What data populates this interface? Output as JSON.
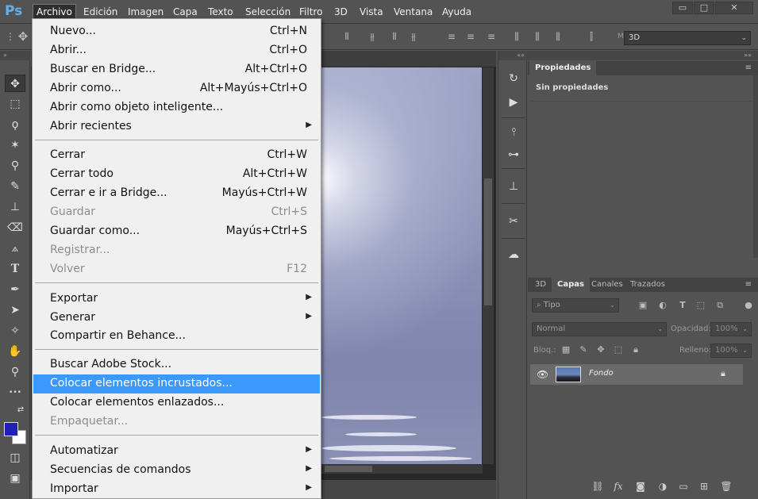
{
  "app": {
    "logo": "Ps"
  },
  "menubar": {
    "items": [
      {
        "label": "Archivo",
        "active": true
      },
      {
        "label": "Edición"
      },
      {
        "label": "Imagen"
      },
      {
        "label": "Capa"
      },
      {
        "label": "Texto"
      },
      {
        "label": "Selección"
      },
      {
        "label": "Filtro"
      },
      {
        "label": "3D"
      },
      {
        "label": "Vista"
      },
      {
        "label": "Ventana"
      },
      {
        "label": "Ayuda"
      }
    ]
  },
  "window_controls": {
    "minimize": "▭",
    "maximize": "□",
    "close": "✕"
  },
  "options_bar": {
    "mode_label": "M",
    "mode_value": "3D"
  },
  "archivo_menu": {
    "items": [
      {
        "label": "Nuevo...",
        "shortcut": "Ctrl+N"
      },
      {
        "label": "Abrir...",
        "shortcut": "Ctrl+O"
      },
      {
        "label": "Buscar en Bridge...",
        "shortcut": "Alt+Ctrl+O"
      },
      {
        "label": "Abrir como...",
        "shortcut": "Alt+Mayús+Ctrl+O"
      },
      {
        "label": "Abrir como objeto inteligente..."
      },
      {
        "label": "Abrir recientes",
        "submenu": true
      },
      {
        "label": "Cerrar",
        "shortcut": "Ctrl+W"
      },
      {
        "label": "Cerrar todo",
        "shortcut": "Alt+Ctrl+W"
      },
      {
        "label": "Cerrar e ir a Bridge...",
        "shortcut": "Mayús+Ctrl+W"
      },
      {
        "label": "Guardar",
        "shortcut": "Ctrl+S",
        "disabled": true
      },
      {
        "label": "Guardar como...",
        "shortcut": "Mayús+Ctrl+S"
      },
      {
        "label": "Registrar...",
        "disabled": true
      },
      {
        "label": "Volver",
        "shortcut": "F12",
        "disabled": true
      },
      {
        "label": "Exportar",
        "submenu": true
      },
      {
        "label": "Generar",
        "submenu": true
      },
      {
        "label": "Compartir en Behance..."
      },
      {
        "label": "Buscar Adobe Stock..."
      },
      {
        "label": "Colocar elementos incrustados...",
        "highlighted": true
      },
      {
        "label": "Colocar elementos enlazados..."
      },
      {
        "label": "Empaquetar...",
        "disabled": true
      },
      {
        "label": "Automatizar",
        "submenu": true
      },
      {
        "label": "Secuencias de comandos",
        "submenu": true
      },
      {
        "label": "Importar",
        "submenu": true
      }
    ],
    "submenu_glyph": "▶",
    "highlight_color": "#3b99fc"
  },
  "tools": {
    "collapse": "»",
    "move": "✥",
    "marquee": "⬚",
    "lasso": "ϙ",
    "wand": "✶",
    "eyedropper": "⚲",
    "brush": "✎",
    "stamp": "⊥",
    "eraser": "⌫",
    "fill": "⟑",
    "type": "T",
    "pen": "✒",
    "path_select": "➤",
    "shape": "✧",
    "hand": "✋",
    "zoom": "⚲",
    "more": "•••",
    "swap": "⇄",
    "quick_mask": "◫",
    "screen_mode": "▣",
    "foreground_color": "#2020b8",
    "background_color": "#ffffff"
  },
  "icon_strip": {
    "collapse": "««"
  },
  "right_panels": {
    "collapse": "»»",
    "properties": {
      "tab": "Propiedades",
      "empty_text": "Sin propiedades"
    },
    "layers": {
      "tabs": [
        "3D",
        "Capas",
        "Canales",
        "Trazados"
      ],
      "active_tab": "Capas",
      "kind_filter": "Tipo",
      "blend_mode": "Normal",
      "opacity_label": "Opacidad:",
      "opacity_value": "100%",
      "lock_label": "Bloq.:",
      "fill_label": "Relleno:",
      "fill_value": "100%",
      "layer": {
        "name": "Fondo",
        "visible": true,
        "locked": true
      }
    }
  }
}
